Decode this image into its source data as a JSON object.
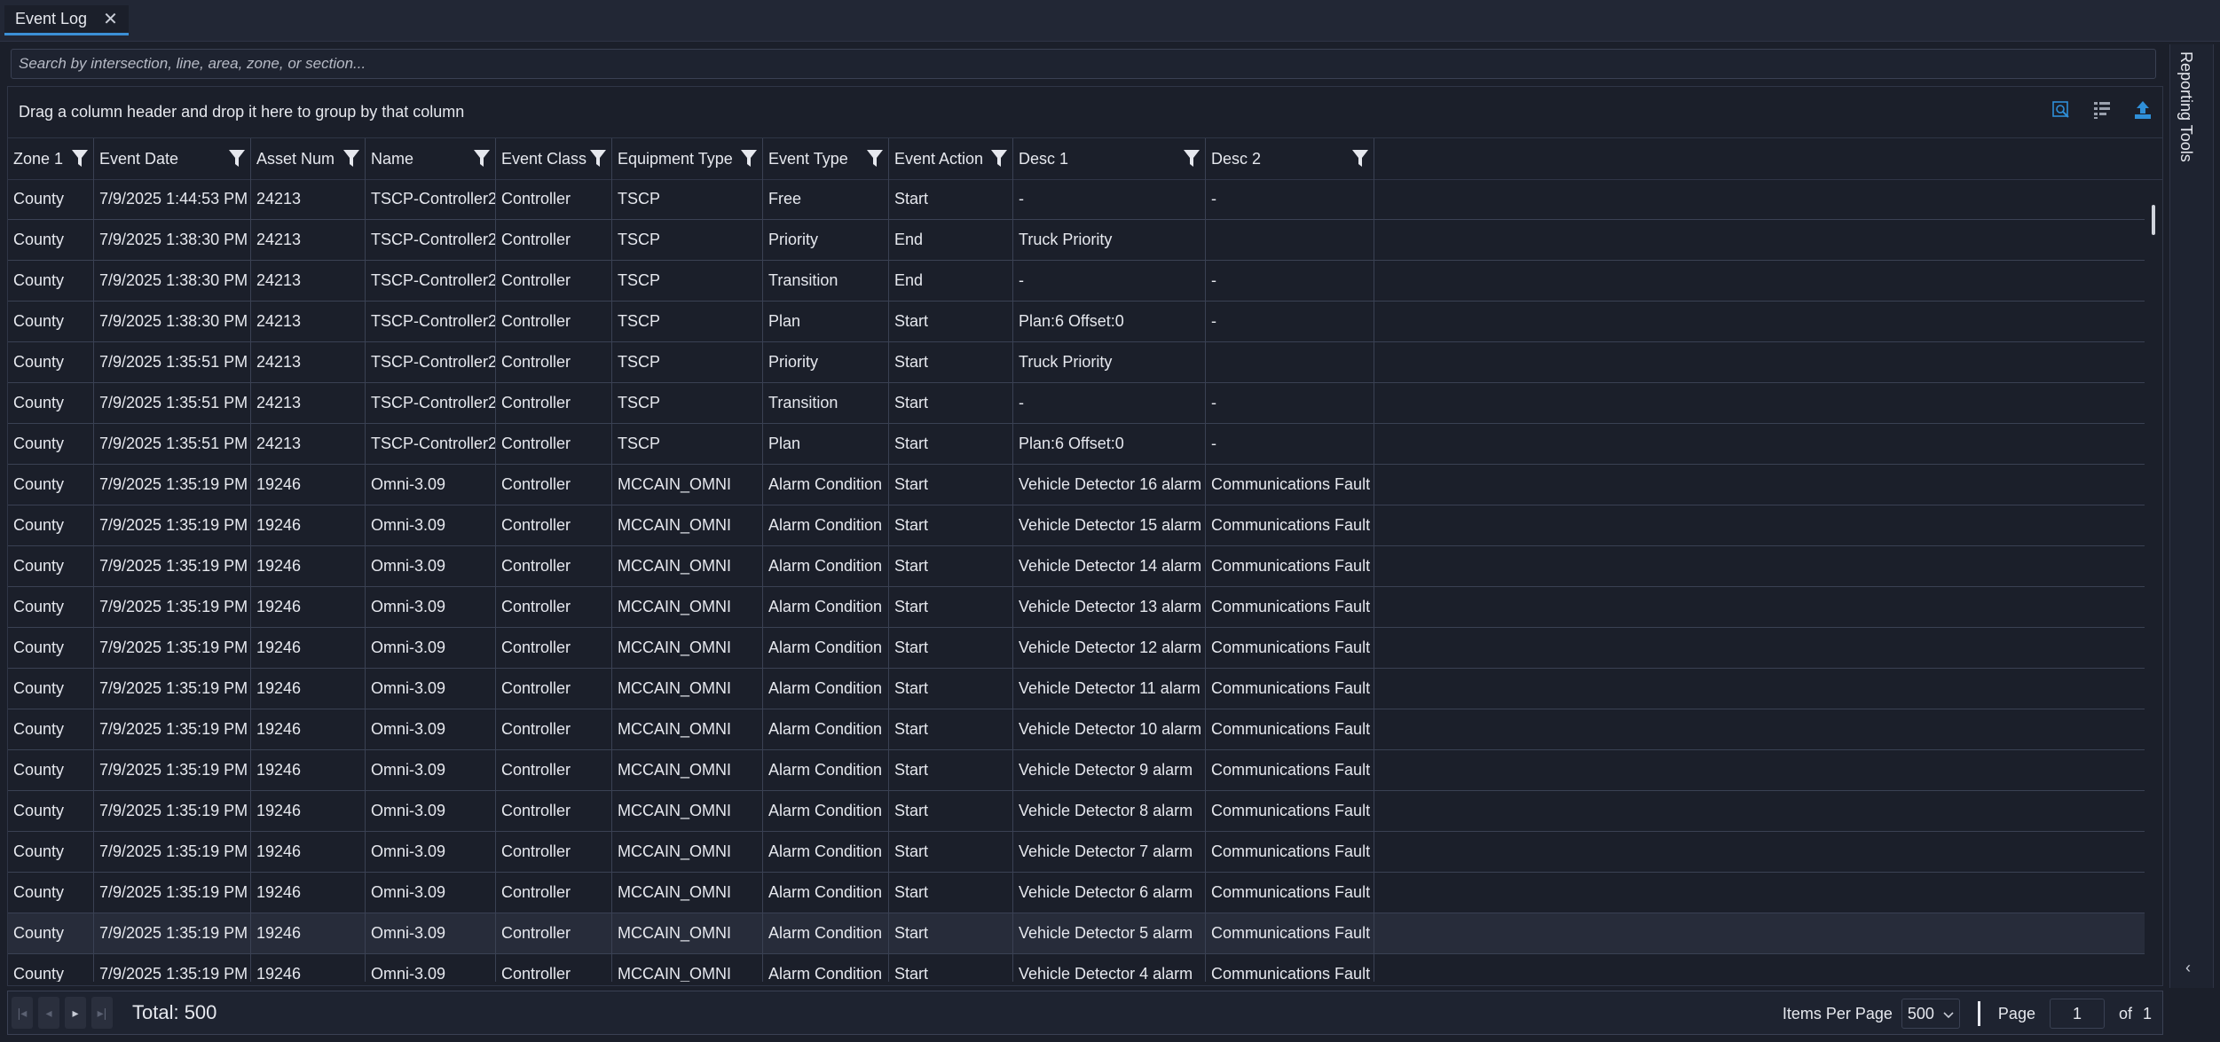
{
  "tab": {
    "title": "Event Log",
    "close_glyph": "✕"
  },
  "search": {
    "placeholder": "Search by intersection, line, area, zone, or section..."
  },
  "group_panel": {
    "text": "Drag a column header and drop it here to group by that column"
  },
  "toolbar": {
    "icons": [
      "search-grid-icon",
      "column-chooser-icon",
      "export-icon"
    ],
    "accent": "#2f8fd8"
  },
  "columns": [
    "Zone 1",
    "Event Date",
    "Asset Num",
    "Name",
    "Event Class",
    "Equipment Type",
    "Event Type",
    "Event Action",
    "Desc 1",
    "Desc 2"
  ],
  "rows": [
    [
      "County",
      "7/9/2025 1:44:53 PM",
      "24213",
      "TSCP-Controller2",
      "Controller",
      "TSCP",
      "Free",
      "Start",
      "-",
      "-"
    ],
    [
      "County",
      "7/9/2025 1:38:30 PM",
      "24213",
      "TSCP-Controller2",
      "Controller",
      "TSCP",
      "Priority",
      "End",
      "Truck Priority",
      ""
    ],
    [
      "County",
      "7/9/2025 1:38:30 PM",
      "24213",
      "TSCP-Controller2",
      "Controller",
      "TSCP",
      "Transition",
      "End",
      "-",
      "-"
    ],
    [
      "County",
      "7/9/2025 1:38:30 PM",
      "24213",
      "TSCP-Controller2",
      "Controller",
      "TSCP",
      "Plan",
      "Start",
      "Plan:6 Offset:0",
      "-"
    ],
    [
      "County",
      "7/9/2025 1:35:51 PM",
      "24213",
      "TSCP-Controller2",
      "Controller",
      "TSCP",
      "Priority",
      "Start",
      "Truck Priority",
      ""
    ],
    [
      "County",
      "7/9/2025 1:35:51 PM",
      "24213",
      "TSCP-Controller2",
      "Controller",
      "TSCP",
      "Transition",
      "Start",
      "-",
      "-"
    ],
    [
      "County",
      "7/9/2025 1:35:51 PM",
      "24213",
      "TSCP-Controller2",
      "Controller",
      "TSCP",
      "Plan",
      "Start",
      "Plan:6 Offset:0",
      "-"
    ],
    [
      "County",
      "7/9/2025 1:35:19 PM",
      "19246",
      "Omni-3.09",
      "Controller",
      "MCCAIN_OMNI",
      "Alarm Condition",
      "Start",
      "Vehicle Detector 16 alarm",
      "Communications Fault"
    ],
    [
      "County",
      "7/9/2025 1:35:19 PM",
      "19246",
      "Omni-3.09",
      "Controller",
      "MCCAIN_OMNI",
      "Alarm Condition",
      "Start",
      "Vehicle Detector 15 alarm",
      "Communications Fault"
    ],
    [
      "County",
      "7/9/2025 1:35:19 PM",
      "19246",
      "Omni-3.09",
      "Controller",
      "MCCAIN_OMNI",
      "Alarm Condition",
      "Start",
      "Vehicle Detector 14 alarm",
      "Communications Fault"
    ],
    [
      "County",
      "7/9/2025 1:35:19 PM",
      "19246",
      "Omni-3.09",
      "Controller",
      "MCCAIN_OMNI",
      "Alarm Condition",
      "Start",
      "Vehicle Detector 13 alarm",
      "Communications Fault"
    ],
    [
      "County",
      "7/9/2025 1:35:19 PM",
      "19246",
      "Omni-3.09",
      "Controller",
      "MCCAIN_OMNI",
      "Alarm Condition",
      "Start",
      "Vehicle Detector 12 alarm",
      "Communications Fault"
    ],
    [
      "County",
      "7/9/2025 1:35:19 PM",
      "19246",
      "Omni-3.09",
      "Controller",
      "MCCAIN_OMNI",
      "Alarm Condition",
      "Start",
      "Vehicle Detector 11 alarm",
      "Communications Fault"
    ],
    [
      "County",
      "7/9/2025 1:35:19 PM",
      "19246",
      "Omni-3.09",
      "Controller",
      "MCCAIN_OMNI",
      "Alarm Condition",
      "Start",
      "Vehicle Detector 10 alarm",
      "Communications Fault"
    ],
    [
      "County",
      "7/9/2025 1:35:19 PM",
      "19246",
      "Omni-3.09",
      "Controller",
      "MCCAIN_OMNI",
      "Alarm Condition",
      "Start",
      "Vehicle Detector 9 alarm",
      "Communications Fault"
    ],
    [
      "County",
      "7/9/2025 1:35:19 PM",
      "19246",
      "Omni-3.09",
      "Controller",
      "MCCAIN_OMNI",
      "Alarm Condition",
      "Start",
      "Vehicle Detector 8 alarm",
      "Communications Fault"
    ],
    [
      "County",
      "7/9/2025 1:35:19 PM",
      "19246",
      "Omni-3.09",
      "Controller",
      "MCCAIN_OMNI",
      "Alarm Condition",
      "Start",
      "Vehicle Detector 7 alarm",
      "Communications Fault"
    ],
    [
      "County",
      "7/9/2025 1:35:19 PM",
      "19246",
      "Omni-3.09",
      "Controller",
      "MCCAIN_OMNI",
      "Alarm Condition",
      "Start",
      "Vehicle Detector 6 alarm",
      "Communications Fault"
    ],
    [
      "County",
      "7/9/2025 1:35:19 PM",
      "19246",
      "Omni-3.09",
      "Controller",
      "MCCAIN_OMNI",
      "Alarm Condition",
      "Start",
      "Vehicle Detector 5 alarm",
      "Communications Fault"
    ],
    [
      "County",
      "7/9/2025 1:35:19 PM",
      "19246",
      "Omni-3.09",
      "Controller",
      "MCCAIN_OMNI",
      "Alarm Condition",
      "Start",
      "Vehicle Detector 4 alarm",
      "Communications Fault"
    ]
  ],
  "highlighted_row": 18,
  "footer": {
    "total_label": "Total: 500",
    "items_per_page_label": "Items Per Page",
    "items_per_page_value": "500",
    "page_label": "Page",
    "page_value": "1",
    "of_label": "of",
    "page_count": "1"
  },
  "side_panel": {
    "label": "Reporting Tools",
    "chevron_glyph": "‹"
  }
}
